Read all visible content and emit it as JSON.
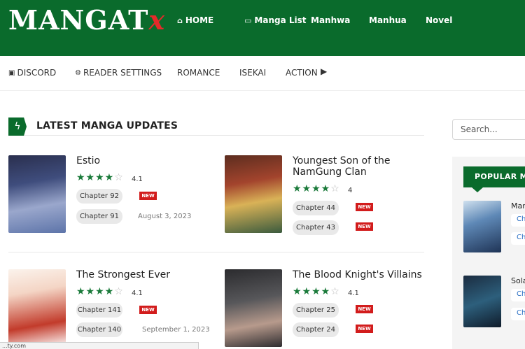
{
  "header": {
    "logo_main": "MANGAT",
    "logo_x": "x",
    "nav": [
      {
        "label": "HOME",
        "icon": "home-icon"
      },
      {
        "label": "Manga List",
        "icon": "folder-icon"
      },
      {
        "label": "Manhwa"
      },
      {
        "label": "Manhua"
      },
      {
        "label": "Novel"
      }
    ]
  },
  "subnav": [
    {
      "label": "DISCORD",
      "icon": "discord-icon"
    },
    {
      "label": "READER SETTINGS",
      "icon": "gears-icon"
    },
    {
      "label": "ROMANCE"
    },
    {
      "label": "ISEKAI"
    },
    {
      "label": "ACTION"
    }
  ],
  "section": {
    "title": "LATEST MANGA UPDATES"
  },
  "search": {
    "placeholder": "Search..."
  },
  "popular": {
    "title": "POPULAR MA",
    "items": [
      {
        "name": "Mar",
        "chapters": [
          "Ch",
          "Ch"
        ]
      },
      {
        "name": "Sola",
        "chapters": [
          "Ch",
          "Ch"
        ]
      }
    ]
  },
  "cards": [
    {
      "title": "Estio",
      "rating": "4.1",
      "stars": 4,
      "chapters": [
        {
          "label": "Chapter 92",
          "badge": "NEW",
          "date": ""
        },
        {
          "label": "Chapter 91",
          "badge": "",
          "date": "August 3, 2023"
        }
      ]
    },
    {
      "title": "Youngest Son of the NamGung Clan",
      "rating": "4",
      "stars": 4,
      "chapters": [
        {
          "label": "Chapter 44",
          "badge": "NEW",
          "date": ""
        },
        {
          "label": "Chapter 43",
          "badge": "NEW",
          "date": ""
        }
      ]
    },
    {
      "title": "The Strongest Ever",
      "rating": "4.1",
      "stars": 4,
      "chapters": [
        {
          "label": "Chapter 141",
          "badge": "NEW",
          "date": ""
        },
        {
          "label": "Chapter 140",
          "badge": "",
          "date": "September 1, 2023"
        }
      ]
    },
    {
      "title": "The Blood Knight's Villains",
      "rating": "4.1",
      "stars": 4,
      "chapters": [
        {
          "label": "Chapter 25",
          "badge": "NEW",
          "date": ""
        },
        {
          "label": "Chapter 24",
          "badge": "NEW",
          "date": ""
        }
      ]
    }
  ],
  "status_bar": {
    "text": "...ty.com"
  },
  "colors": {
    "brand_green": "#0a6b2c",
    "new_badge": "#d21c1c",
    "star_green": "#1a7a3a"
  }
}
